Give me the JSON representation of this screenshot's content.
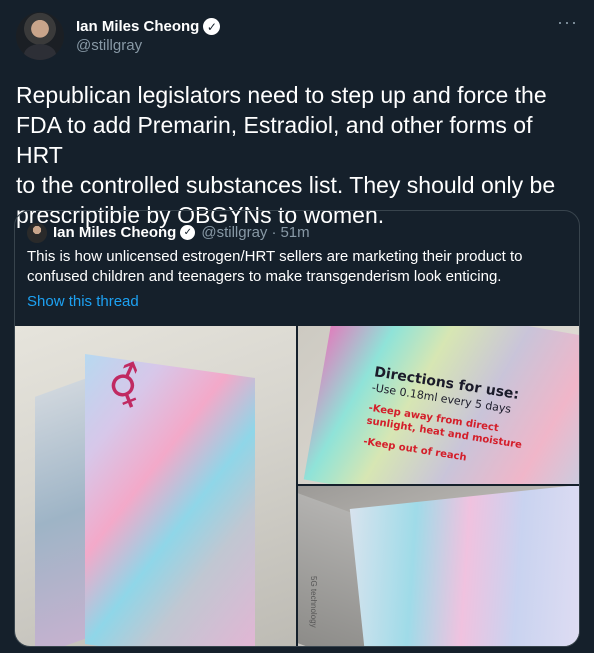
{
  "tweet": {
    "author": {
      "display_name": "Ian Miles Cheong",
      "handle": "@stillgray",
      "verified_icon": "verified-badge-icon"
    },
    "more_label": "···",
    "text": "Republican legislators need to step up and force the\nFDA to add Premarin, Estradiol, and other forms of HRT\nto the controlled substances list. They should only be\nprescriptible by OBGYNs to women."
  },
  "quote": {
    "author": {
      "display_name": "Ian Miles Cheong",
      "handle": "@stillgray",
      "separator": "·",
      "time": "51m"
    },
    "text": "This is how unlicensed estrogen/HRT sellers are marketing their product to confused children and teenagers to make transgenderism look enticing.",
    "show_thread": "Show this thread",
    "media": {
      "symbol": "⚥",
      "directions_title": "Directions for use:",
      "directions_line": "-Use 0.18ml every 5 days",
      "warning_1": "-Keep away from direct",
      "warning_2": "sunlight, heat and moisture",
      "warning_3": "-Keep out of reach",
      "side_caption": "5G technology"
    }
  },
  "colors": {
    "background": "#15202b",
    "secondary_text": "#8899a6",
    "link": "#1da1f2",
    "border": "#38444d"
  }
}
